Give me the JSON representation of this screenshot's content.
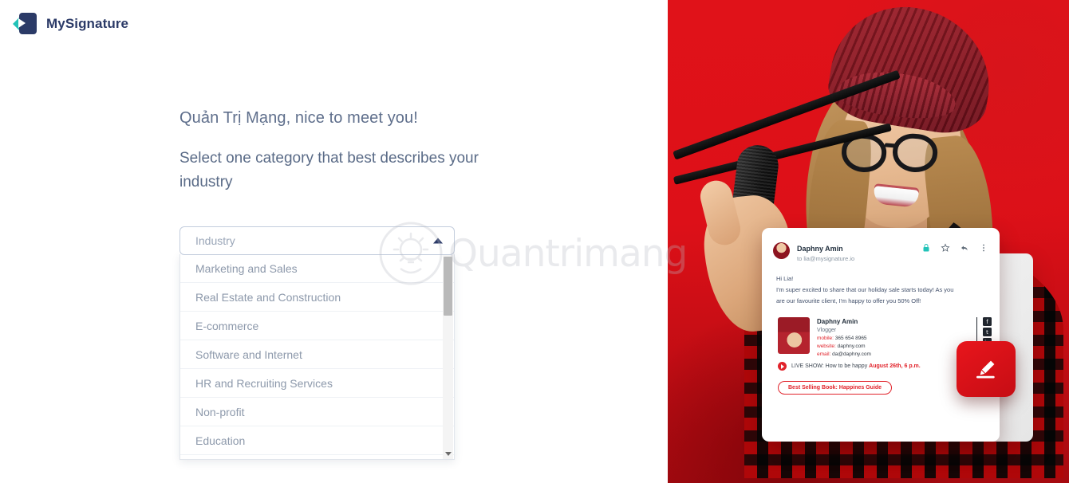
{
  "brand": {
    "name": "MySignature",
    "logo_icon": "mysignature-logo-icon",
    "accent": "#22c3b8",
    "navy": "#2b3a67"
  },
  "main": {
    "greeting": "Quản Trị Mạng, nice to meet you!",
    "subtitle": "Select one category that best describes your industry"
  },
  "industry_select": {
    "placeholder": "Industry",
    "value": "",
    "expanded": true,
    "caret_icon": "caret-up-icon",
    "options": [
      "Marketing and Sales",
      "Real Estate and Construction",
      "E-commerce",
      "Software and Internet",
      "HR and Recruiting Services",
      "Non-profit",
      "Education"
    ],
    "scrollbar": {
      "down_arrow_icon": "scroll-down-arrow-icon"
    }
  },
  "watermark": {
    "text": "Quantrimang",
    "logo_icon": "quantrimang-bulb-icon"
  },
  "promo": {
    "background_color": "#d8141b",
    "photo_alt": "woman-vlogger-with-microphone-photo",
    "email_card": {
      "avatar_icon": "sender-avatar",
      "sender_name": "Daphny Amin",
      "recipient": "to lia@mysignature.io",
      "actions": [
        {
          "icon": "lock-icon",
          "color": "#22c3b8"
        },
        {
          "icon": "star-icon",
          "color": "#5f6b78"
        },
        {
          "icon": "reply-icon",
          "color": "#5f6b78"
        },
        {
          "icon": "more-vertical-icon",
          "color": "#5f6b78"
        }
      ],
      "body_lines": [
        "Hi Lia!",
        "I'm super excited to share that our holiday sale starts today! As you",
        "are our favourite client, I'm happy to offer you 50% Off!"
      ],
      "signature": {
        "photo_icon": "signature-portrait",
        "name": "Daphny Amin",
        "role": "Vlogger",
        "contacts": [
          {
            "label": "mobile:",
            "value": "365 654 8965"
          },
          {
            "label": "website:",
            "value": "daphny.com"
          },
          {
            "label": "email:",
            "value": "da@daphny.com"
          }
        ],
        "social": [
          {
            "icon": "facebook-icon",
            "glyph": "f"
          },
          {
            "icon": "twitter-icon",
            "glyph": "t"
          },
          {
            "icon": "linkedin-icon",
            "glyph": "in"
          }
        ]
      },
      "live_show": {
        "play_icon": "play-circle-icon",
        "text": "LIVE SHOW: How to be happy ",
        "date": "August 26th, 6 p.m."
      },
      "book_button": "Best Selling Book: Happines Guide"
    },
    "fab": {
      "icon": "signature-pen-icon",
      "color": "#e1232b"
    }
  }
}
